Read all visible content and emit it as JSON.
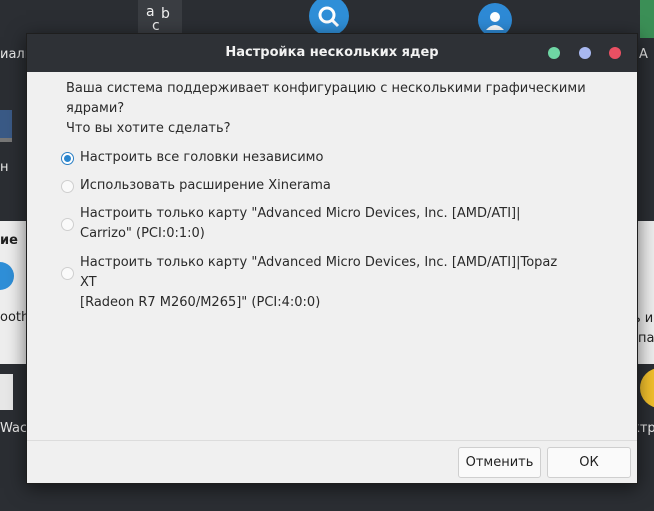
{
  "dialog": {
    "title": "Настройка нескольких ядер",
    "intro_line1": "Ваша система поддерживает конфигурацию с несколькими графическими",
    "intro_line2": "ядрами?",
    "intro_line3": "Что вы хотите сделать?",
    "options": [
      {
        "line1": "Настроить все головки независимо",
        "line2": "",
        "selected": true
      },
      {
        "line1": "Использовать расширение Xinerama",
        "line2": "",
        "selected": false
      },
      {
        "line1": "Настроить только карту \"Advanced Micro Devices, Inc. [AMD/ATI]|",
        "line2": "Carrizo\" (PCI:0:1:0)",
        "selected": false
      },
      {
        "line1": "Настроить только карту \"Advanced Micro Devices, Inc. [AMD/ATI]|Topaz XT",
        "line2": "[Radeon R7 M260/M265]\" (PCI:4:0:0)",
        "selected": false
      }
    ],
    "cancel_label": "Отменить",
    "ok_label": "ОК"
  },
  "background": {
    "left_labels": [
      "иалы",
      "н",
      "ие",
      "ooth",
      "Wac"
    ],
    "right_labels": [
      "ь ис",
      "па",
      "ктр"
    ],
    "abc_icon_text": "abc"
  },
  "colors": {
    "titlebar": "#2e3136",
    "dot_green": "#6fd6a4",
    "dot_blue": "#a8b8f0",
    "dot_red": "#ea5063",
    "radio_active": "#2a86cf"
  }
}
